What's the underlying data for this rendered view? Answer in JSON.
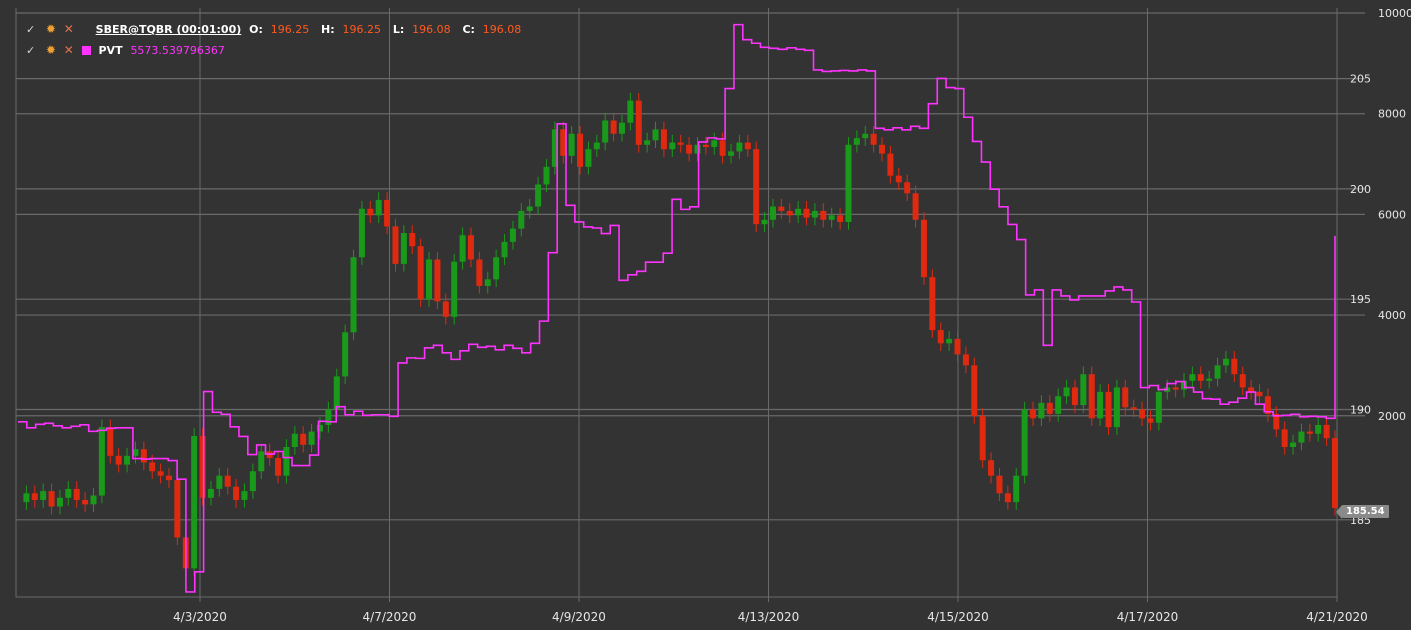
{
  "legend": {
    "security": "SBER@TQBR (00:01:00)",
    "ohlc": [
      {
        "k": "O:",
        "v": "196.25"
      },
      {
        "k": "H:",
        "v": "196.25"
      },
      {
        "k": "L:",
        "v": "196.08"
      },
      {
        "k": "C:",
        "v": "196.08"
      }
    ],
    "pvt_name": "PVT",
    "pvt_value": "5573.539796367",
    "icons": [
      "check-icon",
      "gear-icon",
      "close-icon",
      "color-swatch-icon"
    ]
  },
  "last_price_label": "185.54",
  "colors": {
    "background": "#333333",
    "up": "#1a9a1a",
    "down": "#e02a10",
    "pvt": "#ff33ff",
    "grid": "#6a6a6a"
  },
  "chart_data": {
    "type": "line",
    "x_tick_labels": [
      "4/3/2020",
      "4/7/2020",
      "4/9/2020",
      "4/13/2020",
      "4/15/2020",
      "4/17/2020",
      "4/21/2020"
    ],
    "price_axis": {
      "ticks": [
        185,
        190,
        195,
        200,
        205
      ],
      "range": [
        181.5,
        208.2
      ]
    },
    "pvt_axis": {
      "ticks": [
        2000,
        4000,
        6000,
        8000,
        10000
      ],
      "range": [
        -1600,
        10100
      ]
    },
    "grid": true,
    "series": [
      {
        "name": "SBER@TQBR",
        "kind": "price",
        "values": [
          185.8,
          186.2,
          185.9,
          186.3,
          185.6,
          186.0,
          186.4,
          185.9,
          185.7,
          186.1,
          189.2,
          187.9,
          187.5,
          187.9,
          188.2,
          187.6,
          187.2,
          187.0,
          186.8,
          184.2,
          182.8,
          188.8,
          186.0,
          186.4,
          187.0,
          186.5,
          185.9,
          186.3,
          187.2,
          188.1,
          187.8,
          187.0,
          188.3,
          188.9,
          188.4,
          189.0,
          189.3,
          190.0,
          191.5,
          193.5,
          196.9,
          199.1,
          198.8,
          199.5,
          198.3,
          196.6,
          198.0,
          197.4,
          195.0,
          196.8,
          194.9,
          194.2,
          196.7,
          197.9,
          196.8,
          195.6,
          195.9,
          196.9,
          197.6,
          198.2,
          199.0,
          199.2,
          200.2,
          201.0,
          202.7,
          201.5,
          202.5,
          201.0,
          201.8,
          202.1,
          203.1,
          202.5,
          203.0,
          204.0,
          202.0,
          202.2,
          202.7,
          201.8,
          202.1,
          202.0,
          201.6,
          202.0,
          201.9,
          202.2,
          201.5,
          201.7,
          202.1,
          201.8,
          198.4,
          198.6,
          199.2,
          199.0,
          198.8,
          199.1,
          198.7,
          199.0,
          198.6,
          198.8,
          198.5,
          202.0,
          202.3,
          202.5,
          202.0,
          201.6,
          200.6,
          200.3,
          199.8,
          198.6,
          196.0,
          193.6,
          193.0,
          193.2,
          192.5,
          192.0,
          189.7,
          187.7,
          187.0,
          186.2,
          185.8,
          187.0,
          190.0,
          189.6,
          190.3,
          189.8,
          190.6,
          191.0,
          190.2,
          191.6,
          189.6,
          190.8,
          189.2,
          191.0,
          190.1,
          190.0,
          189.6,
          189.4,
          190.8,
          191.0,
          190.9,
          191.3,
          191.6,
          191.3,
          191.4,
          192.0,
          192.3,
          191.6,
          191.0,
          190.8,
          190.6,
          189.8,
          189.1,
          188.3,
          188.5,
          189.0,
          188.9,
          189.3,
          188.7,
          185.54
        ]
      },
      {
        "name": "PVT",
        "kind": "indicator",
        "values": [
          1880,
          1760,
          1830,
          1850,
          1800,
          1760,
          1790,
          1820,
          1690,
          1710,
          1750,
          1760,
          1760,
          1150,
          1140,
          1150,
          1150,
          1110,
          740,
          -1500,
          -1100,
          2480,
          2070,
          2030,
          1780,
          1590,
          1230,
          1420,
          1240,
          1290,
          1170,
          1010,
          1010,
          1220,
          1890,
          1880,
          2180,
          2020,
          2090,
          2010,
          2020,
          2020,
          1990,
          3050,
          3150,
          3140,
          3350,
          3400,
          3250,
          3120,
          3290,
          3420,
          3360,
          3380,
          3310,
          3400,
          3340,
          3250,
          3440,
          3880,
          5240,
          7800,
          6180,
          5850,
          5750,
          5730,
          5620,
          5780,
          4690,
          4800,
          4870,
          5050,
          5050,
          5230,
          6300,
          6100,
          6150,
          7440,
          7520,
          7500,
          8500,
          9770,
          9470,
          9400,
          9320,
          9300,
          9280,
          9310,
          9280,
          9260,
          8870,
          8840,
          8850,
          8860,
          8850,
          8870,
          8850,
          7710,
          7680,
          7720,
          7680,
          7750,
          7710,
          8200,
          8700,
          8520,
          8500,
          7930,
          7450,
          7040,
          6500,
          6150,
          5800,
          5500,
          4400,
          4500,
          3400,
          4500,
          4380,
          4300,
          4380,
          4380,
          4380,
          4480,
          4560,
          4500,
          4260,
          2560,
          2600,
          2520,
          2640,
          2680,
          2560,
          2470,
          2340,
          2330,
          2230,
          2270,
          2350,
          2470,
          2230,
          2080,
          2000,
          2010,
          2030,
          1980,
          1990,
          1980,
          1950,
          5573.539796367
        ]
      }
    ]
  }
}
